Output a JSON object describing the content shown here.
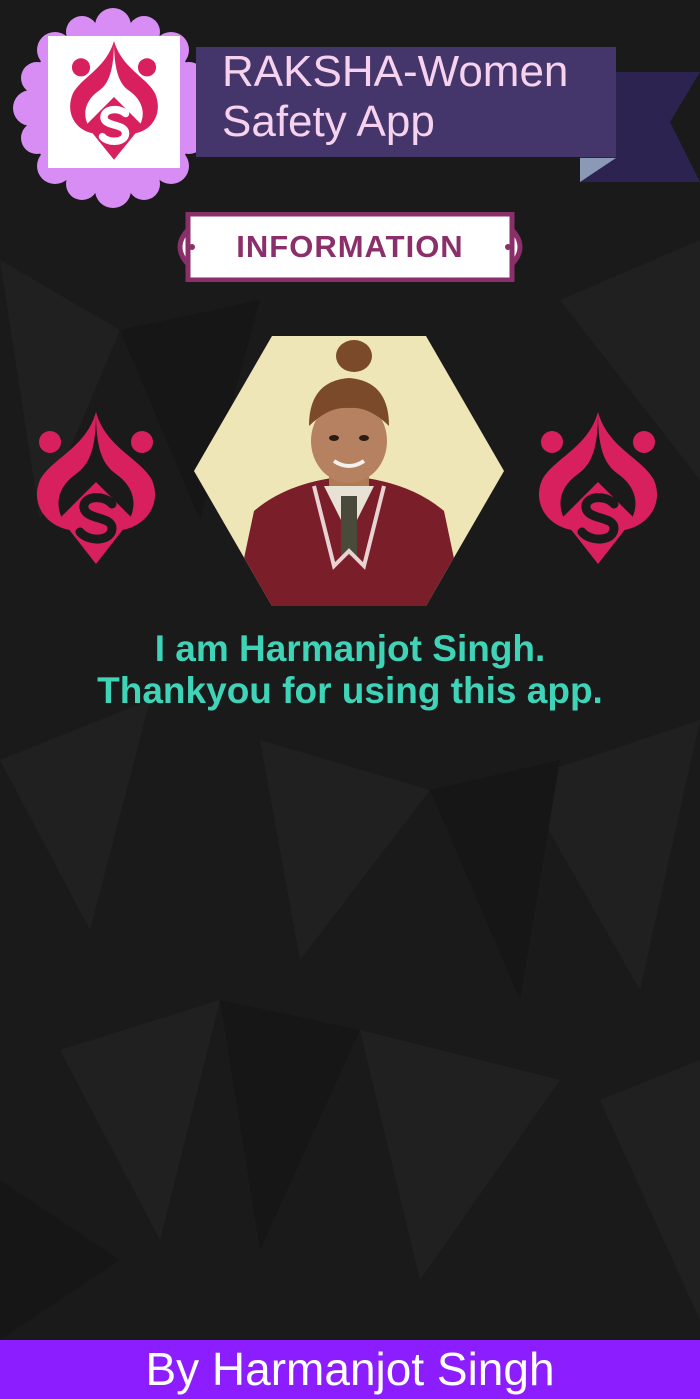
{
  "app": {
    "title_line1": "RAKSHA-Women",
    "title_line2": "Safety App"
  },
  "section": {
    "label": "INFORMATION"
  },
  "profile": {
    "photo_icon": "profile-photo",
    "message_line1": "I am Harmanjot Singh.",
    "message_line2": "Thankyou for using this app."
  },
  "footer": {
    "credit": "By Harmanjot Singh"
  },
  "colors": {
    "background": "#1a1a1a",
    "badge": "#d88df5",
    "banner": "#44356a",
    "banner_text": "#f6d2ef",
    "tag_border": "#8b2f6a",
    "message": "#3fd3b8",
    "footer": "#8c1dff",
    "logo_pink": "#e0226a"
  }
}
